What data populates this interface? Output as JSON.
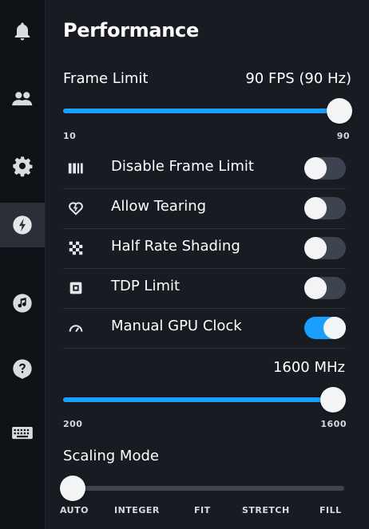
{
  "sidebar": {
    "items": [
      {
        "icon": "bell-icon"
      },
      {
        "icon": "friends-icon"
      },
      {
        "icon": "gear-icon"
      },
      {
        "icon": "lightning-icon",
        "active": true
      },
      {
        "icon": "music-icon"
      },
      {
        "icon": "help-icon"
      },
      {
        "icon": "keyboard-icon"
      }
    ]
  },
  "header": {
    "title": "Performance"
  },
  "frame_limit": {
    "label": "Frame Limit",
    "value_text": "90 FPS (90 Hz)",
    "min_label": "10",
    "max_label": "90",
    "min": 10,
    "max": 90,
    "value": 90
  },
  "toggles": [
    {
      "label": "Disable Frame Limit",
      "icon": "bars-icon",
      "on": false
    },
    {
      "label": "Allow Tearing",
      "icon": "heart-icon",
      "on": false
    },
    {
      "label": "Half Rate Shading",
      "icon": "checker-icon",
      "on": false
    },
    {
      "label": "TDP Limit",
      "icon": "chip-icon",
      "on": false
    },
    {
      "label": "Manual GPU Clock",
      "icon": "gauge-icon",
      "on": true
    }
  ],
  "gpu_clock": {
    "value_text": "1600 MHz",
    "min_label": "200",
    "max_label": "1600",
    "min": 200,
    "max": 1600,
    "value": 1600
  },
  "scaling_mode": {
    "label": "Scaling Mode",
    "options": [
      "AUTO",
      "INTEGER",
      "FIT",
      "STRETCH",
      "FILL"
    ],
    "selected_index": 0
  },
  "colors": {
    "accent": "#1a9fff",
    "track": "#3d4450",
    "panel": "#181c22"
  }
}
